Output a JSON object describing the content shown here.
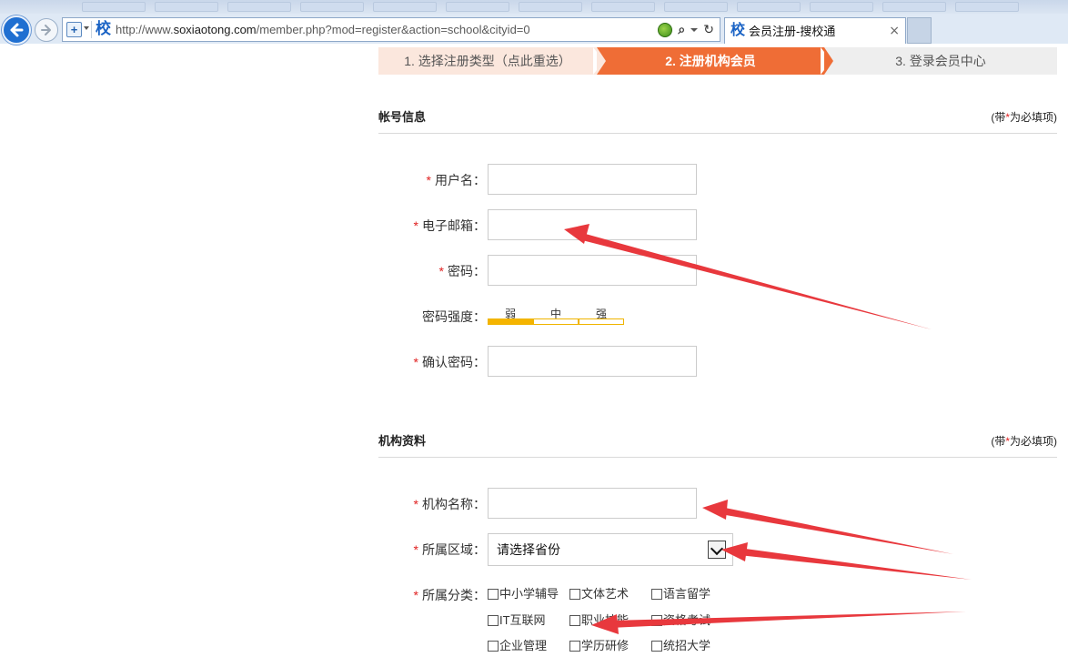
{
  "browser": {
    "url_prefix": "http://www.",
    "url_domain": "soxiaotong.com",
    "url_path": "/member.php?mod=register&action=school&cityid=0",
    "site_icon": "校",
    "tab_icon": "校",
    "tab_title": "会员注册-搜校通",
    "tab_close": "×"
  },
  "steps": [
    {
      "label": "1. 选择注册类型（点此重选）"
    },
    {
      "label": "2. 注册机构会员"
    },
    {
      "label": "3. 登录会员中心"
    }
  ],
  "account_section": {
    "title": "帐号信息",
    "required_note_prefix": "(带",
    "required_note_star": "*",
    "required_note_suffix": "为必填项)",
    "fields": {
      "username": "用户名：",
      "email": "电子邮箱：",
      "password": "密码：",
      "strength": "密码强度：",
      "confirm": "确认密码："
    },
    "strength_levels": [
      "弱",
      "中",
      "强"
    ],
    "strength_level": 1
  },
  "org_section": {
    "title": "机构资料",
    "required_note_prefix": "(带",
    "required_note_star": "*",
    "required_note_suffix": "为必填项)",
    "fields": {
      "name": "机构名称：",
      "region": "所属区域：",
      "category": "所属分类："
    },
    "region_selected": "请选择省份",
    "categories": [
      "中小学辅导",
      "文体艺术",
      "语言留学",
      "IT互联网",
      "职业技能",
      "资格考试",
      "企业管理",
      "学历研修",
      "统招大学"
    ]
  },
  "required_star": "*",
  "colors": {
    "accent": "#ef6d36",
    "required": "#e02020",
    "annotation_arrow": "#e8383d"
  }
}
